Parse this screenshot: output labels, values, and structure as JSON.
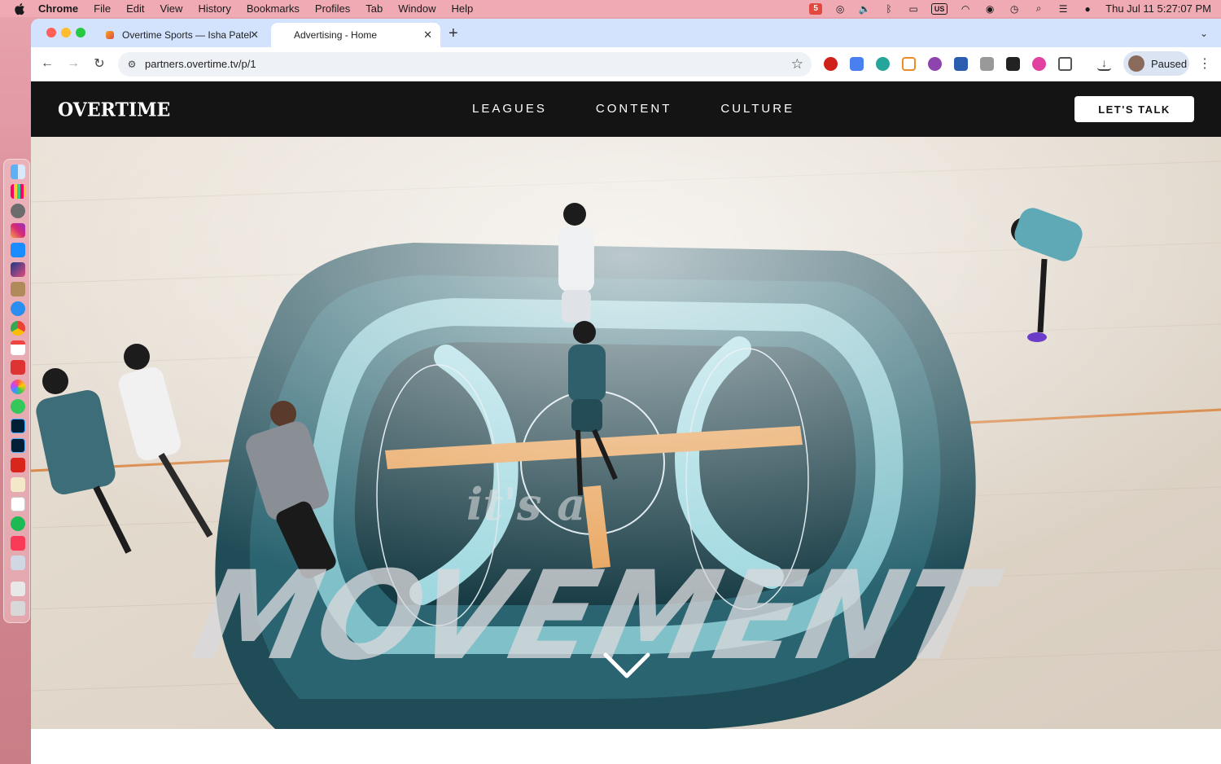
{
  "menubar": {
    "app": "Chrome",
    "items": [
      "File",
      "Edit",
      "View",
      "History",
      "Bookmarks",
      "Profiles",
      "Tab",
      "Window",
      "Help"
    ],
    "keyboard": "US",
    "clock": "Thu Jul 11  5:27:07 PM"
  },
  "tabs": [
    {
      "title": "Overtime Sports — Isha Patel",
      "active": false
    },
    {
      "title": "Advertising - Home",
      "active": true
    }
  ],
  "toolbar": {
    "url": "partners.overtime.tv/p/1",
    "profile_label": "Paused"
  },
  "site": {
    "logo": "OVERTIME",
    "nav": [
      "LEAGUES",
      "CONTENT",
      "CULTURE"
    ],
    "cta": "LET'S TALK"
  },
  "hero": {
    "overlay_small": "it's a",
    "overlay_big": "MOVEMENT"
  },
  "colors": {
    "header_bg": "#141414",
    "court_teal": "#1f4c57",
    "court_light_teal": "#8fd0d8",
    "court_orange": "#e8a35a",
    "floor": "#e3dacd"
  }
}
